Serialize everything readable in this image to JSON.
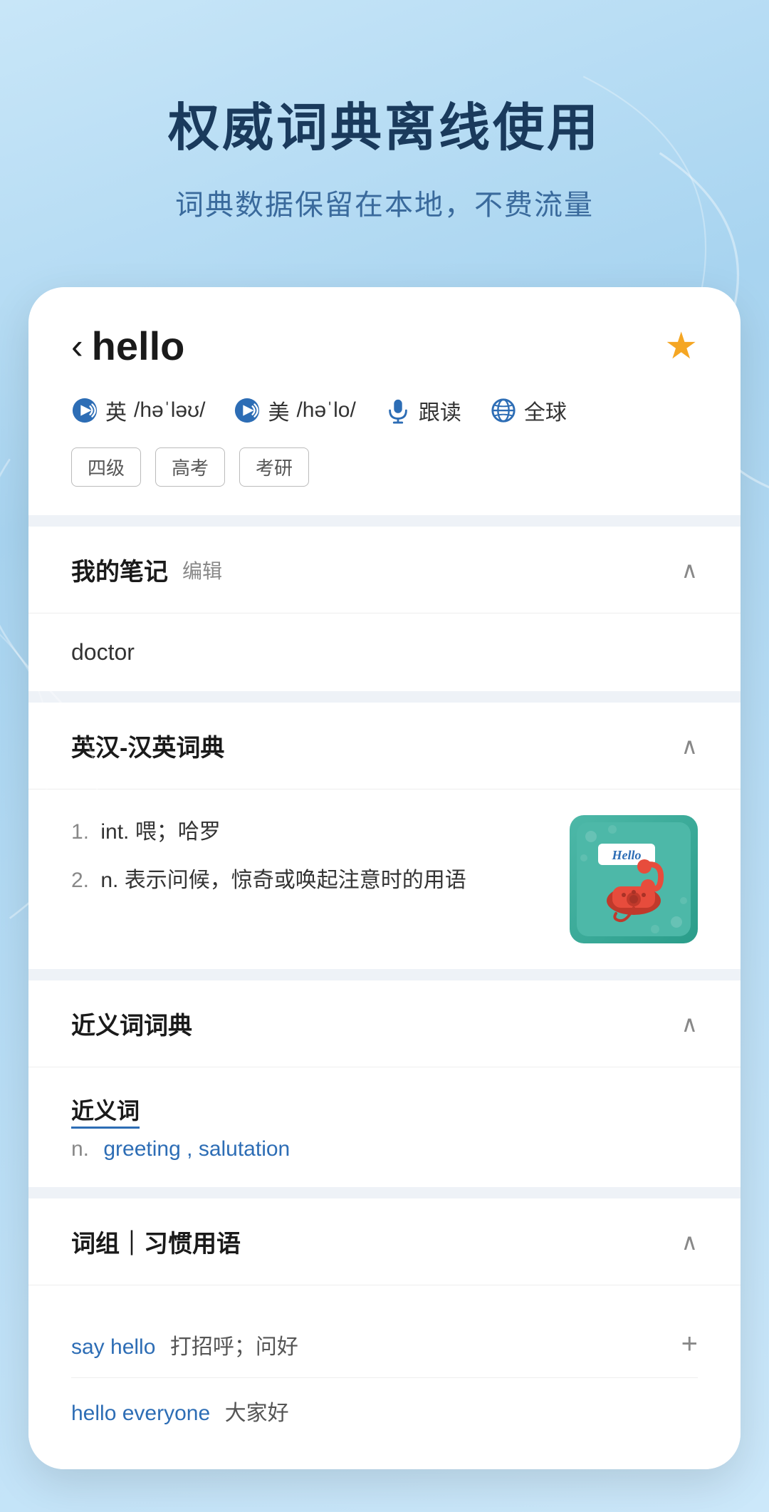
{
  "background": {
    "title": "权威词典离线使用",
    "subtitle": "词典数据保留在本地，不费流量"
  },
  "word_header": {
    "back_arrow": "‹",
    "word": "hello",
    "star_color": "#f5a623",
    "pronunciations": [
      {
        "label": "英",
        "phonetic": "/həˈləʊ/",
        "icon": "volume"
      },
      {
        "label": "美",
        "phonetic": "/həˈlo/",
        "icon": "volume"
      }
    ],
    "follow_read": "跟读",
    "global": "全球",
    "tags": [
      "四级",
      "高考",
      "考研"
    ]
  },
  "sections": {
    "my_notes": {
      "title": "我的笔记",
      "edit_label": "编辑",
      "content": "doctor",
      "collapsed": false
    },
    "dictionary": {
      "title": "英汉-汉英词典",
      "collapsed": false,
      "definitions": [
        {
          "number": "1.",
          "pos": "int.",
          "text": "喂；哈罗"
        },
        {
          "number": "2.",
          "pos": "n.",
          "text": "表示问候，惊奇或唤起注意时的用语"
        }
      ]
    },
    "synonyms": {
      "title": "近义词词典",
      "collapsed": false,
      "label": "近义词",
      "pos": "n.",
      "words": [
        "greeting",
        "salutation"
      ]
    },
    "phrases": {
      "title": "词组｜习惯用语",
      "collapsed": false,
      "items": [
        {
          "en": "say hello",
          "cn": "打招呼；问好",
          "has_add": true
        },
        {
          "en": "hello everyone",
          "cn": "大家好",
          "has_add": false
        }
      ]
    }
  }
}
